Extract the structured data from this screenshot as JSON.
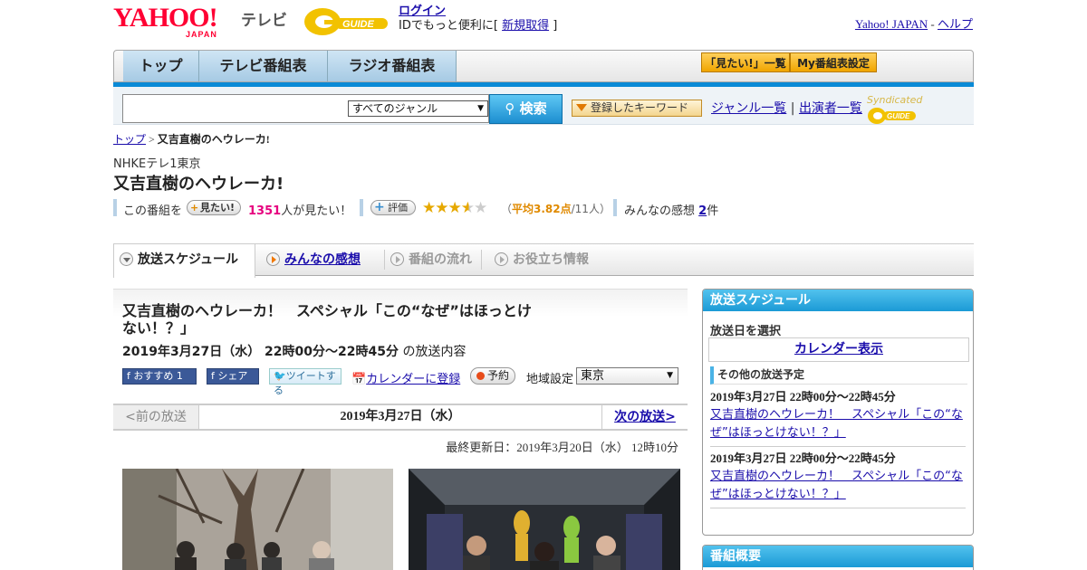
{
  "header": {
    "yahoo_logo": "YAHOO!",
    "yahoo_sub": "JAPAN",
    "tv_label": "テレビ",
    "gguide_logo": "G-GUIDE",
    "login": "ログイン",
    "login_msg_prefix": "IDでもっと便利に[",
    "signup": "新規取得",
    "login_msg_suffix": "]",
    "yahoo_japan_link": "Yahoo! JAPAN",
    "help_link": "ヘルプ",
    "dash": " - "
  },
  "nav": {
    "tabs": [
      "トップ",
      "テレビ番組表",
      "ラジオ番組表"
    ],
    "want_list": "「見たい!」一覧",
    "my_schedule": "My番組表設定"
  },
  "search": {
    "genre_selected": "すべてのジャンル",
    "button": "検索",
    "keywords": "登録したキーワード",
    "genre_list": "ジャンル一覧",
    "separator": "|",
    "performer_list": "出演者一覧",
    "syndicated": "Syndicated"
  },
  "breadcrumb": {
    "top": "トップ",
    "sep": " > ",
    "current": "又吉直樹のヘウレーカ!"
  },
  "program": {
    "channel": "NHKEテレ1東京",
    "title": "又吉直樹のヘウレーカ!",
    "this_program": "この番組を",
    "want_btn": "見たい!",
    "want_count": "1351",
    "want_suffix": "人が見たい！",
    "rate_btn": "評価",
    "stars": "★★★★★",
    "avg_prefix": "（",
    "avg_label": "平均3.82点",
    "avg_suffix": "/11人）",
    "rating": 3.82,
    "impressions_label": "みんなの感想",
    "impressions_count": "2",
    "impressions_unit": "件"
  },
  "content_tabs": [
    "放送スケジュール",
    "みんなの感想",
    "番組の流れ",
    "お役立ち情報"
  ],
  "episode": {
    "title": "又吉直樹のヘウレーカ！　スペシャル「この“なぜ”はほっとけない！？」",
    "date": "2019年3月27日（水）  22時00分～22時45分",
    "date_suffix": "の放送内容",
    "fb_recommend": "おすすめ",
    "fb_count": "1",
    "fb_share": "シェア",
    "tweet": "ツイートする",
    "calendar": "カレンダーに登録",
    "reserve": "予約",
    "region_label": "地域設定",
    "region": "東京",
    "prev": "<前の放送",
    "current_date": "2019年3月27日（水）",
    "next": "次の放送>",
    "updated": "最終更新日：2019年3月20日（水）  12時10分"
  },
  "sidebar": {
    "header": "放送スケジュール",
    "select_date": "放送日を選択",
    "calendar": "カレンダー表示",
    "other_header": "その他の放送予定",
    "items": [
      {
        "date": "2019年3月27日  22時00分～22時45分",
        "title": "又吉直樹のヘウレーカ！　スペシャル「この“なぜ”はほっとけない！？」"
      },
      {
        "date": "2019年3月27日  22時00分～22時45分",
        "title": "又吉直樹のヘウレーカ！　スペシャル「この“なぜ”はほっとけない！？」"
      }
    ],
    "overview_header": "番組概要"
  },
  "colors": {
    "brand_red": "#ff0033",
    "accent_blue": "#1b9ad6",
    "link": "#1a0dab",
    "pink": "#e6007e",
    "orange": "#e08a00"
  }
}
